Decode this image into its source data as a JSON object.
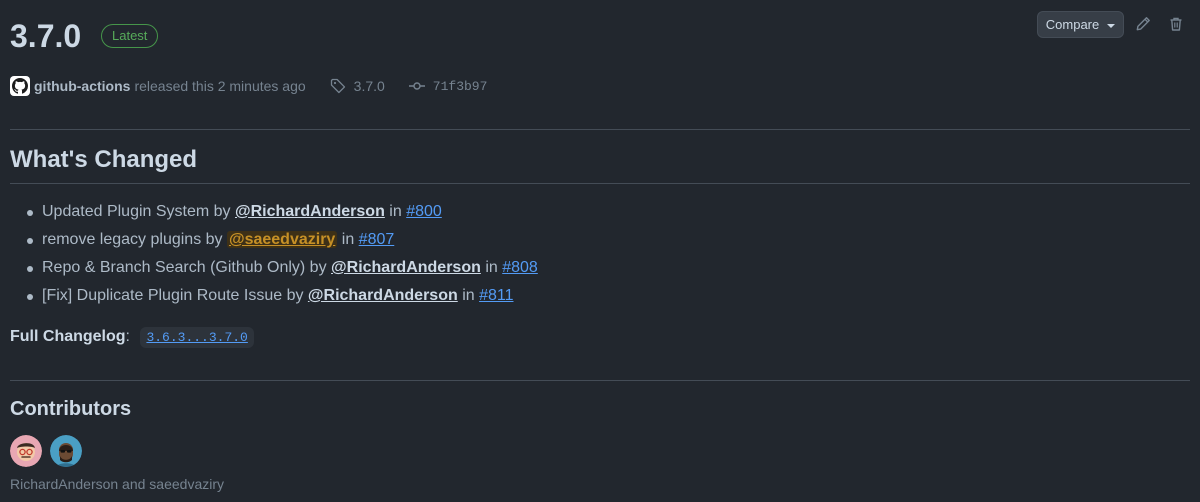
{
  "release": {
    "title": "3.7.0",
    "badge": "Latest",
    "author": "github-actions",
    "released_text": "released this 2 minutes ago",
    "tag": "3.7.0",
    "commit": "71f3b97"
  },
  "actions": {
    "compare_label": "Compare",
    "edit_icon": "pencil-icon",
    "delete_icon": "trash-icon"
  },
  "changes": {
    "heading": "What's Changed",
    "items": [
      {
        "text": "Updated Plugin System by ",
        "author": "@RichardAnderson",
        "in": " in ",
        "pr": "#800"
      },
      {
        "text": "remove legacy plugins by ",
        "author": "@saeedvaziry",
        "in": " in ",
        "pr": "#807"
      },
      {
        "text": "Repo & Branch Search (Github Only) by ",
        "author": "@RichardAnderson",
        "in": " in ",
        "pr": "#808"
      },
      {
        "text": "[Fix] Duplicate Plugin Route Issue by ",
        "author": "@RichardAnderson",
        "in": " in ",
        "pr": "#811"
      }
    ]
  },
  "changelog": {
    "label": "Full Changelog",
    "colon": ": ",
    "link": "3.6.3...3.7.0"
  },
  "contributors": {
    "heading": "Contributors",
    "names": "RichardAnderson and saeedvaziry"
  },
  "colors": {
    "background": "#22272e",
    "accent_link": "#539bf5",
    "badge_green": "#57ab5a",
    "mention_highlight": "#c69026"
  }
}
